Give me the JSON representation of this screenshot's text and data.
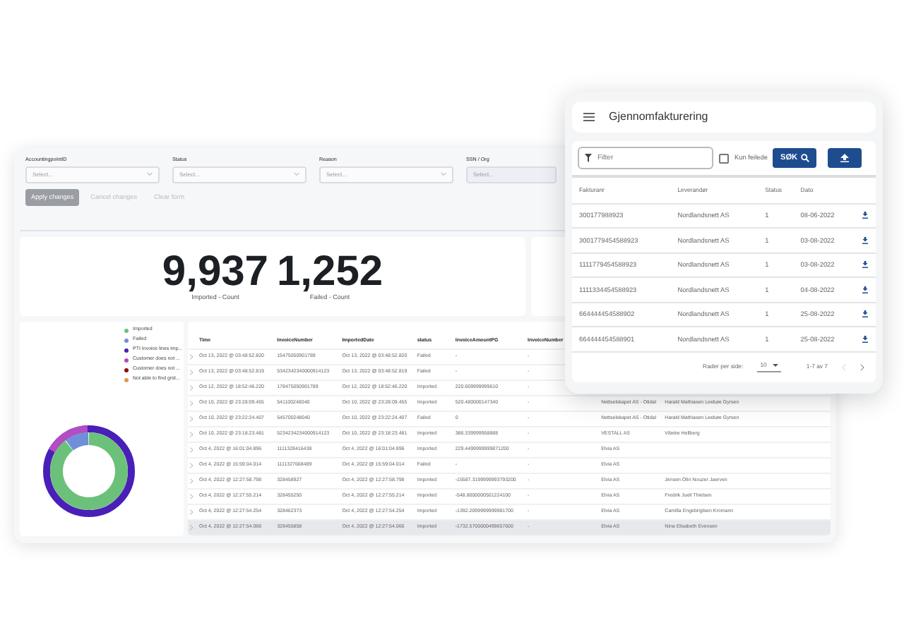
{
  "dashboard": {
    "filters": [
      {
        "label": "AccountingpointID",
        "placeholder": "Select...",
        "disabled": false
      },
      {
        "label": "Status",
        "placeholder": "Select...",
        "disabled": false
      },
      {
        "label": "Reason",
        "placeholder": "Select...",
        "disabled": false
      },
      {
        "label": "SSN / Org",
        "placeholder": "Select...",
        "disabled": true
      }
    ],
    "buttons": [
      {
        "label": "Apply changes",
        "kind": "filled"
      },
      {
        "label": "Cancel changes",
        "kind": "text"
      },
      {
        "label": "Clear form",
        "kind": "text"
      }
    ],
    "metrics": [
      {
        "value": "9,937",
        "label": "Imported - Count"
      },
      {
        "value": "1,252",
        "label": "Failed - Count"
      }
    ],
    "legend": [
      {
        "label": "Imported",
        "color": "#6cc17a"
      },
      {
        "label": "Failed",
        "color": "#6f8fd8"
      },
      {
        "label": "PTI Invoice lines imp...",
        "color": "#4a1fb8"
      },
      {
        "label": "Customer does not ...",
        "color": "#b44cc4"
      },
      {
        "label": "Customer does not ...",
        "color": "#8b1010"
      },
      {
        "label": "Not able to find grid...",
        "color": "#e09a4a"
      }
    ],
    "table": {
      "columns": [
        "Time",
        "InvoiceNumber",
        "ImportedDate",
        "status",
        "InvoiceAmountPG",
        "InvoiceNumber"
      ],
      "rows": [
        {
          "cells": [
            "Oct 13, 2022 @ 03:48:52.820",
            "15475050901789",
            "Oct 13, 2022 @ 03:48:52.820",
            "Failed",
            "-",
            "-"
          ],
          "selected": false
        },
        {
          "cells": [
            "Oct 13, 2022 @ 03:48:52.819",
            "5342342340000914123",
            "Oct 13, 2022 @ 03:48:52.819",
            "Failed",
            "-",
            "-"
          ],
          "selected": false
        },
        {
          "cells": [
            "Oct 12, 2022 @ 18:52:46.220",
            "178475050901789",
            "Oct 12, 2022 @ 18:52:46.220",
            "Imported",
            "220.609999999610",
            "-"
          ],
          "selected": false
        },
        {
          "cells": [
            "Oct 10, 2022 @ 23:28:09.455",
            "541100248040",
            "Oct 10, 2022 @ 23:28:09.455",
            "Imported",
            "520.480000147340",
            "-",
            "Nettselskapet AS - Otidal",
            "Harald Mathiasen Leebøe Gyrsen"
          ],
          "selected": false
        },
        {
          "cells": [
            "Oct 10, 2022 @ 23:22:24.407",
            "545700248040",
            "Oct 10, 2022 @ 23:22:24.407",
            "Failed",
            "0",
            "-",
            "Nettselskapet AS - Otidal",
            "Harald Mathiasen Leebøe Gyrsen"
          ],
          "selected": false
        },
        {
          "cells": [
            "Oct 10, 2022 @ 23:18:23.481",
            "5234234234000914123",
            "Oct 10, 2022 @ 23:18:23.481",
            "Imported",
            "386.339999958888",
            "-",
            "VESTALL AS",
            "Vibeke Hellberg"
          ],
          "selected": false
        },
        {
          "cells": [
            "Oct 4, 2022 @ 16:01:04.896",
            "1111328416438",
            "Oct 4, 2022 @ 16:01:04.896",
            "Imported",
            "229.4499999999871200",
            "-",
            "Elvia AS"
          ],
          "selected": false
        },
        {
          "cells": [
            "Oct 4, 2022 @ 15:59:04.014",
            "1111327668489",
            "Oct 4, 2022 @ 15:59:04.014",
            "Failed",
            "-",
            "-",
            "Elvia AS"
          ],
          "selected": false
        },
        {
          "cells": [
            "Oct 4, 2022 @ 12:27:58.798",
            "328458927",
            "Oct 4, 2022 @ 12:27:58.798",
            "Imported",
            "-15587.3199999993793200",
            "-",
            "Elvia AS",
            "Jensen Olin Nouzer Jaerven"
          ],
          "selected": false
        },
        {
          "cells": [
            "Oct 4, 2022 @ 12:27:55.214",
            "328455250",
            "Oct 4, 2022 @ 12:27:55.214",
            "Imported",
            "-548.8000000501224100",
            "-",
            "Elvia AS",
            "Fredrik Juell Thielsen"
          ],
          "selected": false
        },
        {
          "cells": [
            "Oct 4, 2022 @ 12:27:54.254",
            "328462373",
            "Oct 4, 2022 @ 12:27:54.254",
            "Imported",
            "-1392.2099999999981700",
            "-",
            "Elvia AS",
            "Camilla Engebrigtsen Kromann"
          ],
          "selected": false
        },
        {
          "cells": [
            "Oct 4, 2022 @ 12:27:54.066",
            "328455858",
            "Oct 4, 2022 @ 12:27:54.066",
            "Imported",
            "-1732.5700000499657600",
            "-",
            "Elvia AS",
            "Nina Elisabeth Evensen"
          ],
          "selected": true
        }
      ]
    }
  },
  "invoice_window": {
    "title": "Gjennomfakturering",
    "filter": {
      "placeholder": "Filter"
    },
    "checkbox": {
      "label": "Kun feilede",
      "checked": false
    },
    "search_button": "SØK",
    "columns": [
      "Fakturanr",
      "Leverandør",
      "Status",
      "Dato"
    ],
    "rows": [
      [
        "300177988923",
        "Nordlandsnett AS",
        "1",
        "08-06-2022"
      ],
      [
        "3001779454588923",
        "Nordlandsnett AS",
        "1",
        "03-08-2022"
      ],
      [
        "1111779454588923",
        "Nordlandsnett AS",
        "1",
        "03-08-2022"
      ],
      [
        "1111334454588923",
        "Nordlandsnett AS",
        "1",
        "04-08-2022"
      ],
      [
        "664444454588902",
        "Nordlandsnett AS",
        "1",
        "25-08-2022"
      ],
      [
        "664444454588901",
        "Nordlandsnett AS",
        "1",
        "25-08-2022"
      ]
    ],
    "footer": {
      "rows_label": "Rader per side:",
      "rows_value": "10",
      "range": "1-7 av 7",
      "prev_disabled": true,
      "next_disabled": false
    }
  }
}
